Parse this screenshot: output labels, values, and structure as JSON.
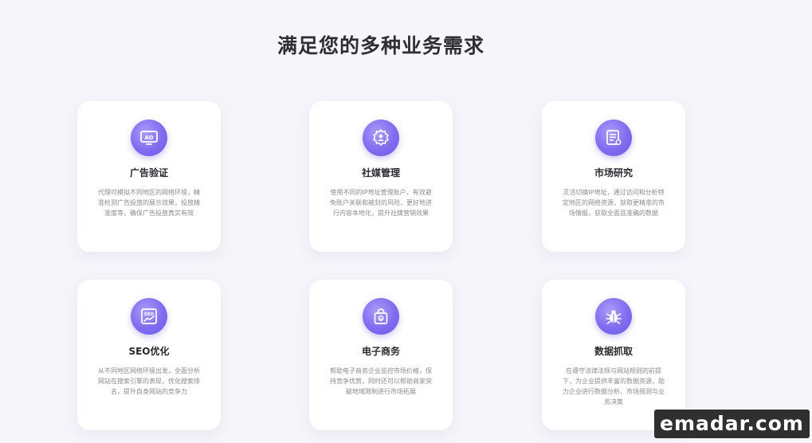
{
  "page": {
    "title": "满足您的多种业务需求"
  },
  "cards": [
    {
      "icon": "ad-icon",
      "title": "广告验证",
      "description": "代理可模拟不同地区的网络环境，精准检测广告投放的展示效果，投放精准度等，确保广告投放真实有效"
    },
    {
      "icon": "social-media-gear-icon",
      "title": "社媒管理",
      "description": "使用不同的IP地址管理账户，有效避免账户关联和被封的风险，更好地进行内容本地化，提升社媒营销效果"
    },
    {
      "icon": "market-report-icon",
      "title": "市场研究",
      "description": "灵活切换IP地址，通过访问和分析特定地区的网络资源，获取更精准的市场情报，获取全面且准确的数据"
    },
    {
      "icon": "seo-chart-icon",
      "title": "SEO优化",
      "description": "从不同地区网络环境出发，全面分析网站在搜索引擎的表现，优化搜索排名，提升自身网站的竞争力"
    },
    {
      "icon": "shopping-bag-icon",
      "title": "电子商务",
      "description": "帮助电子商务企业监控市场价格，保持竞争优势，同时还可以帮助商家突破地域限制进行市场拓展"
    },
    {
      "icon": "bug-crawler-icon",
      "title": "数据抓取",
      "description": "在遵守法律法规与网站规则的前提下，为企业提供丰富的数据资源，助力企业进行数据分析、市场预测与业务决策"
    }
  ],
  "watermark": {
    "text": "emadar.com"
  },
  "colors": {
    "background": "#f6f5fa",
    "card": "#ffffff",
    "accent": "#7f6cf0",
    "title": "#2e2e33",
    "description": "#8a8a93"
  }
}
